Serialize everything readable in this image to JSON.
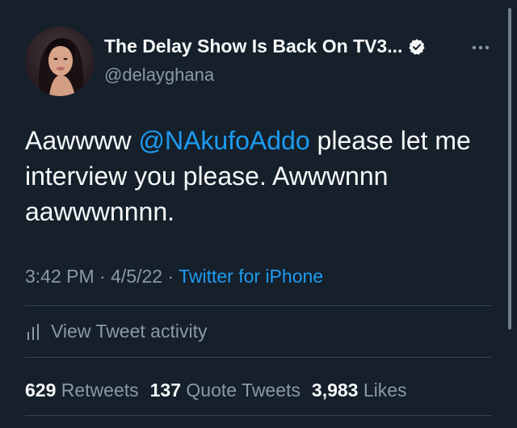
{
  "author": {
    "display_name": "The Delay Show Is Back On TV3...",
    "handle": "@delayghana",
    "verified_icon": "verified-badge-icon",
    "avatar": "profile-photo"
  },
  "tweet": {
    "text_before": "Aawwww ",
    "mention": "@NAkufoAddo",
    "text_after": " please let me interview you please. Awwwnnn aawwwnnnn."
  },
  "meta": {
    "time": "3:42 PM",
    "separator": " · ",
    "date": "4/5/22",
    "source": "Twitter for iPhone"
  },
  "activity": {
    "label": "View Tweet activity",
    "icon": "analytics-bars-icon"
  },
  "stats": {
    "retweets_count": "629",
    "retweets_label": "Retweets",
    "quotes_count": "137",
    "quotes_label": "Quote Tweets",
    "likes_count": "3,983",
    "likes_label": "Likes"
  },
  "colors": {
    "background": "#15202b",
    "text": "#f7f9f9",
    "secondary": "#8b98a5",
    "accent": "#1d9bf0",
    "divider": "#38444d"
  }
}
